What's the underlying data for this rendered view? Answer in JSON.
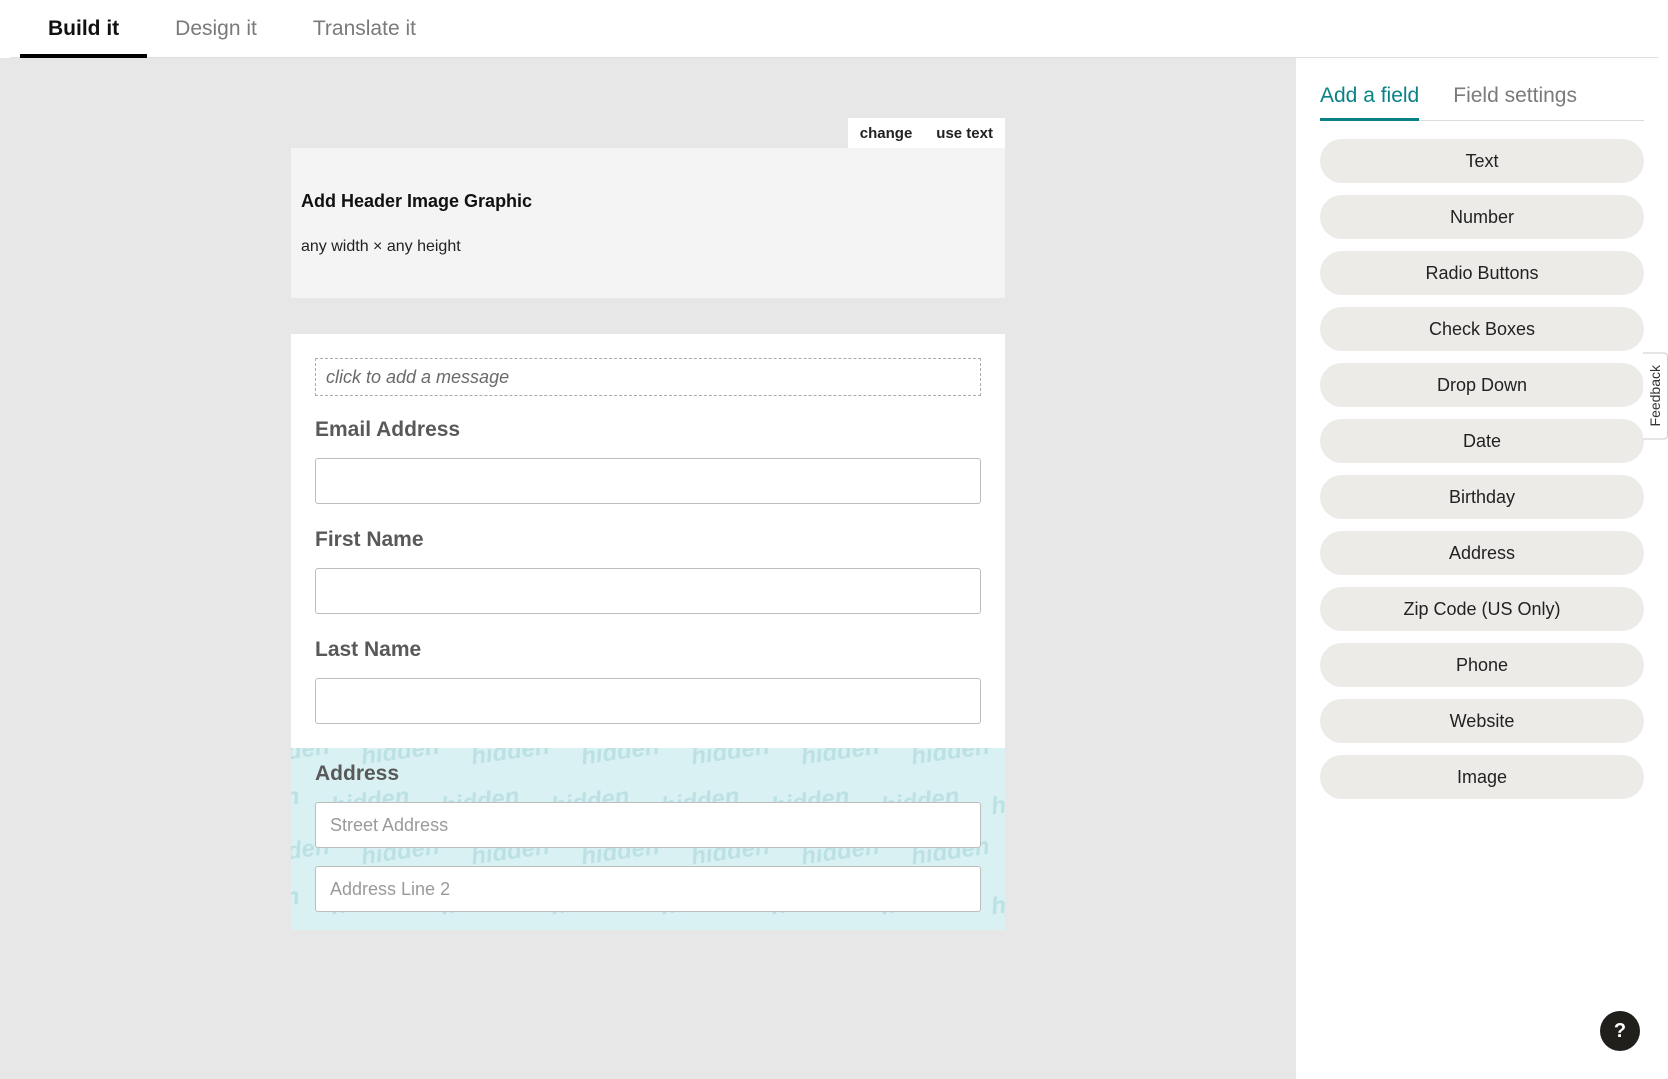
{
  "topTabs": {
    "build": "Build it",
    "design": "Design it",
    "translate": "Translate it"
  },
  "sideTabs": {
    "add": "Add a field",
    "settings": "Field settings"
  },
  "fieldTypes": [
    "Text",
    "Number",
    "Radio Buttons",
    "Check Boxes",
    "Drop Down",
    "Date",
    "Birthday",
    "Address",
    "Zip Code (US Only)",
    "Phone",
    "Website",
    "Image"
  ],
  "headerBox": {
    "changeLabel": "change",
    "useTextLabel": "use text",
    "title": "Add Header Image Graphic",
    "subtitle": "any width × any height"
  },
  "form": {
    "messagePlaceholder": "click to add a message",
    "fields": {
      "email": {
        "label": "Email Address"
      },
      "first": {
        "label": "First Name"
      },
      "last": {
        "label": "Last Name"
      },
      "address": {
        "label": "Address",
        "street_ph": "Street Address",
        "line2_ph": "Address Line 2"
      }
    },
    "hiddenWatermark": "hidden"
  },
  "feedback": "Feedback",
  "help": "?"
}
